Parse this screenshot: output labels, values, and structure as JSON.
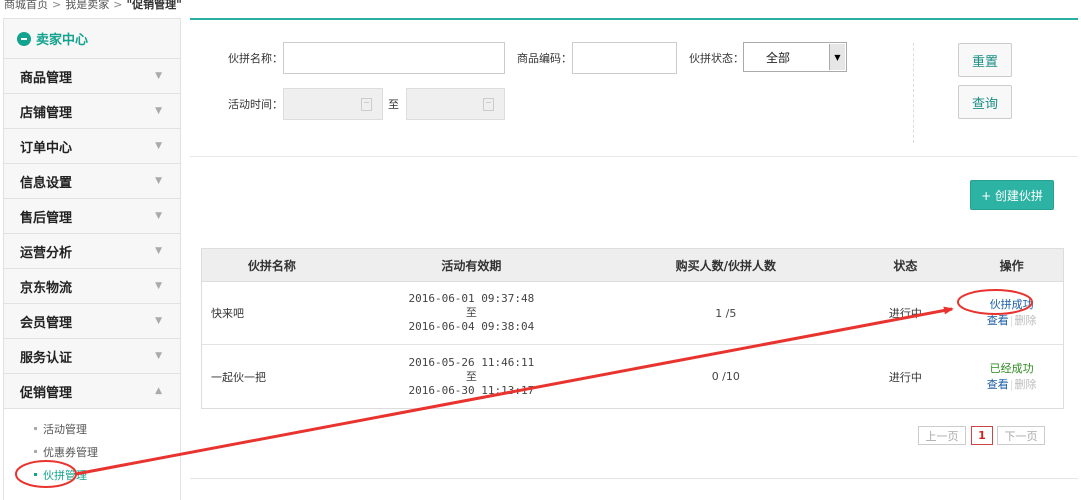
{
  "breadcrumb": {
    "home": "商城首页",
    "sep": ">",
    "seller": "我是卖家",
    "current": "\"促销管理\""
  },
  "sidebar": {
    "title": "卖家中心",
    "items": [
      {
        "label": "商品管理"
      },
      {
        "label": "店铺管理"
      },
      {
        "label": "订单中心"
      },
      {
        "label": "信息设置"
      },
      {
        "label": "售后管理"
      },
      {
        "label": "运营分析"
      },
      {
        "label": "京东物流"
      },
      {
        "label": "会员管理"
      },
      {
        "label": "服务认证"
      },
      {
        "label": "促销管理"
      }
    ],
    "subitems": [
      {
        "label": "活动管理"
      },
      {
        "label": "优惠券管理"
      },
      {
        "label": "伙拼管理"
      }
    ]
  },
  "filter": {
    "name_label": "伙拼名称：",
    "name_value": "",
    "code_label": "商品编码：",
    "code_value": "",
    "status_label": "伙拼状态：",
    "status_value": "全部",
    "time_label": "活动时间：",
    "time_to": "至",
    "reset_label": "重置",
    "query_label": "查询"
  },
  "create_button": "+ 创建伙拼",
  "table": {
    "headers": [
      "伙拼名称",
      "活动有效期",
      "购买人数/伙拼人数",
      "状态",
      "操作"
    ],
    "rows": [
      {
        "name": "快来吧",
        "start": "2016-06-01 09:37:48",
        "to": "至",
        "end": "2016-06-04 09:38:04",
        "count": "1 /5",
        "status": "进行中",
        "op_state": "伙拼成功",
        "view": "查看",
        "sep": "|",
        "del": "删除"
      },
      {
        "name": "一起伙一把",
        "start": "2016-05-26 11:46:11",
        "to": "至",
        "end": "2016-06-30 11:13:17",
        "count": "0 /10",
        "status": "进行中",
        "op_state": "已经成功",
        "view": "查看",
        "sep": "|",
        "del": "删除"
      }
    ]
  },
  "pagination": {
    "prev": "上一页",
    "current": "1",
    "next": "下一页"
  },
  "colors": {
    "accent": "#2cb3a4",
    "annotation": "#e8332e",
    "link": "#1a5fa6"
  }
}
